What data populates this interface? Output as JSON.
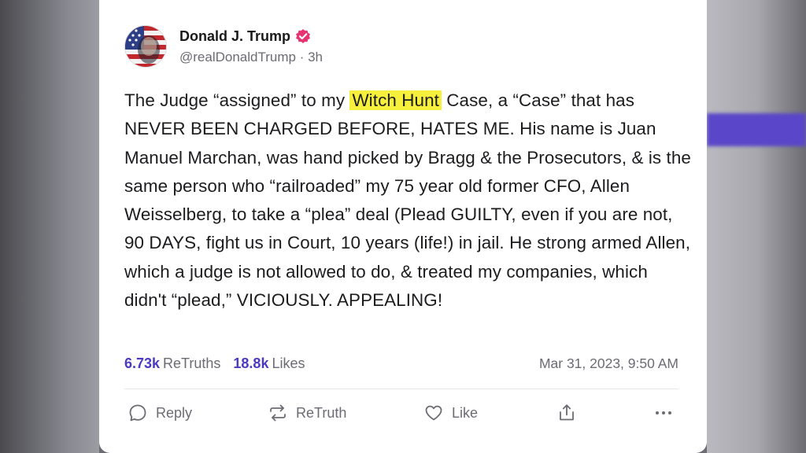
{
  "post": {
    "author_name": "Donald J. Trump",
    "handle": "@realDonaldTrump",
    "separator": " · ",
    "time_ago": "3h",
    "text_before": "The Judge “assigned” to my ",
    "text_highlight": "Witch Hunt",
    "text_after": " Case, a “Case” that has NEVER BEEN CHARGED BEFORE, HATES ME. His name is Juan Manuel Marchan, was hand picked by Bragg & the Prosecutors, & is the same person who “railroaded” my 75 year old former CFO, Allen Weisselberg, to take a “plea” deal (Plead GUILTY, even if you are not, 90 DAYS, fight us in Court, 10 years (life!) in jail. He strong armed Allen, which a judge is not allowed to do, & treated my companies, which didn't “plead,” VICIOUSLY. APPEALING!",
    "retruths_count": "6.73k",
    "retruths_label": "ReTruths",
    "likes_count": "18.8k",
    "likes_label": "Likes",
    "date": "Mar 31, 2023, 9:50 AM"
  },
  "actions": {
    "reply": "Reply",
    "retruth": "ReTruth",
    "like": "Like"
  },
  "icons": {
    "verified": "verified-badge-icon",
    "reply": "reply-icon",
    "retruth": "retruth-icon",
    "like": "heart-icon",
    "share": "share-icon",
    "more": "more-icon"
  },
  "colors": {
    "accent": "#4a3ac0",
    "verified": "#e8336f",
    "highlight": "#f6ef3c"
  }
}
